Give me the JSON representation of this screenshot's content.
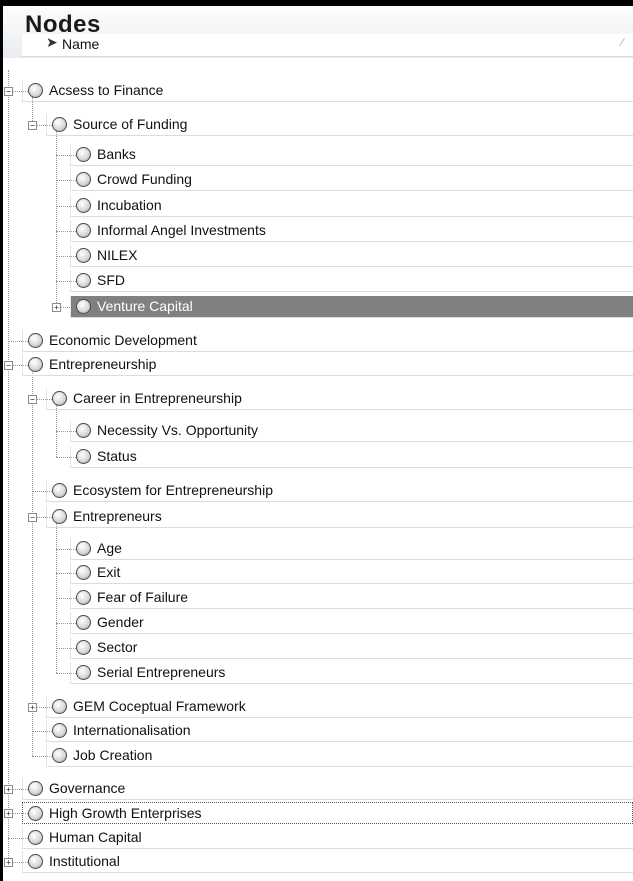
{
  "panel": {
    "title": "Nodes"
  },
  "columns": {
    "name_header": "Name",
    "pin_icon": "pin-icon",
    "sort_icon": "sort-indicator-icon"
  },
  "tree": [
    {
      "label": "Acsess to Finance",
      "level": 0,
      "expander": "minus"
    },
    {
      "label": "Source of Funding",
      "level": 1,
      "expander": "minus"
    },
    {
      "label": "Banks",
      "level": 2
    },
    {
      "label": "Crowd Funding",
      "level": 2
    },
    {
      "label": "Incubation",
      "level": 2
    },
    {
      "label": "Informal Angel Investments",
      "level": 2
    },
    {
      "label": "NILEX",
      "level": 2
    },
    {
      "label": "SFD",
      "level": 2
    },
    {
      "label": "Venture Capital",
      "level": 2,
      "expander": "plus",
      "selected": true
    },
    {
      "label": "Economic Development",
      "level": 0
    },
    {
      "label": "Entrepreneurship",
      "level": 0,
      "expander": "minus"
    },
    {
      "label": "Career in Entrepreneurship",
      "level": 1,
      "expander": "minus"
    },
    {
      "label": "Necessity Vs. Opportunity",
      "level": 2
    },
    {
      "label": "Status",
      "level": 2
    },
    {
      "label": "Ecosystem for Entrepreneurship",
      "level": 1
    },
    {
      "label": "Entrepreneurs",
      "level": 1,
      "expander": "minus"
    },
    {
      "label": "Age",
      "level": 2
    },
    {
      "label": "Exit",
      "level": 2
    },
    {
      "label": "Fear of Failure",
      "level": 2
    },
    {
      "label": "Gender",
      "level": 2
    },
    {
      "label": "Sector",
      "level": 2
    },
    {
      "label": "Serial Entrepreneurs",
      "level": 2
    },
    {
      "label": "GEM Coceptual Framework",
      "level": 1,
      "expander": "plus"
    },
    {
      "label": "Internationalisation",
      "level": 1
    },
    {
      "label": "Job Creation",
      "level": 1
    },
    {
      "label": "Governance",
      "level": 0,
      "expander": "plus"
    },
    {
      "label": "High Growth Enterprises",
      "level": 0,
      "expander": "plus",
      "focused": true
    },
    {
      "label": "Human Capital",
      "level": 0
    },
    {
      "label": "Institutional",
      "level": 0,
      "expander": "plus"
    }
  ],
  "colors": {
    "selected_row": "#808080",
    "header_bg": "#e9edf1"
  }
}
